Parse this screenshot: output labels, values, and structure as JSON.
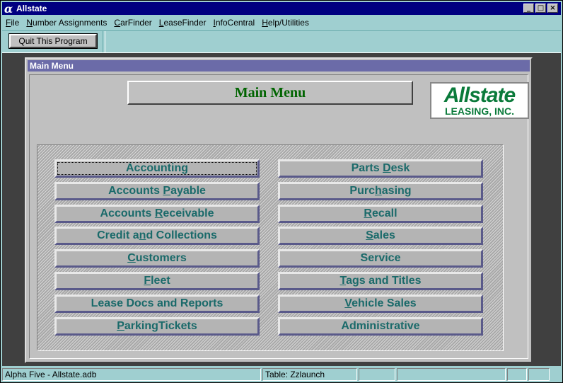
{
  "window": {
    "title": "Allstate",
    "app_icon_glyph": "α",
    "controls": {
      "minimize": "_",
      "maximize": "□",
      "close": "×"
    }
  },
  "menubar": {
    "items": [
      {
        "label": "File",
        "mnemonic": "F"
      },
      {
        "label": "Number Assignments",
        "mnemonic": "N"
      },
      {
        "label": "CarFinder",
        "mnemonic": "C"
      },
      {
        "label": "LeaseFinder",
        "mnemonic": "L"
      },
      {
        "label": "InfoCentral",
        "mnemonic": "I"
      },
      {
        "label": "Help/Utilities",
        "mnemonic": "H"
      }
    ]
  },
  "toolbar": {
    "quit_label": "Quit This Program"
  },
  "child_window": {
    "title": "Main Menu"
  },
  "main": {
    "heading": "Main Menu",
    "logo": {
      "line1": "Allstate",
      "line2": "LEASING, INC."
    },
    "left_buttons": [
      {
        "label": "Accounting",
        "mnemonic": ""
      },
      {
        "label": "Accounts Payable",
        "mnemonic": "P"
      },
      {
        "label": "Accounts Receivable",
        "mnemonic": "R"
      },
      {
        "label": "Credit and Collections",
        "mnemonic": "n"
      },
      {
        "label": "Customers",
        "mnemonic": "C"
      },
      {
        "label": "Fleet",
        "mnemonic": "F"
      },
      {
        "label": "Lease Docs and Reports",
        "mnemonic": ""
      },
      {
        "label": "ParkingTickets",
        "mnemonic": "P"
      }
    ],
    "right_buttons": [
      {
        "label": "Parts Desk",
        "mnemonic": "D"
      },
      {
        "label": "Purchasing",
        "mnemonic": "h"
      },
      {
        "label": "Recall",
        "mnemonic": "R"
      },
      {
        "label": "Sales",
        "mnemonic": "S"
      },
      {
        "label": "Service",
        "mnemonic": ""
      },
      {
        "label": "Tags and Titles",
        "mnemonic": "T"
      },
      {
        "label": "Vehicle Sales",
        "mnemonic": "V"
      },
      {
        "label": "Administrative",
        "mnemonic": ""
      }
    ]
  },
  "status": {
    "db": "Alpha Five - Allstate.adb",
    "table": "Table: Zzlaunch"
  },
  "colors": {
    "title_bar": "#000080",
    "child_title_bar": "#6b6ba8",
    "heading_green": "#006400",
    "button_text": "#1a6a6a",
    "logo_green": "#0a7a3a"
  }
}
